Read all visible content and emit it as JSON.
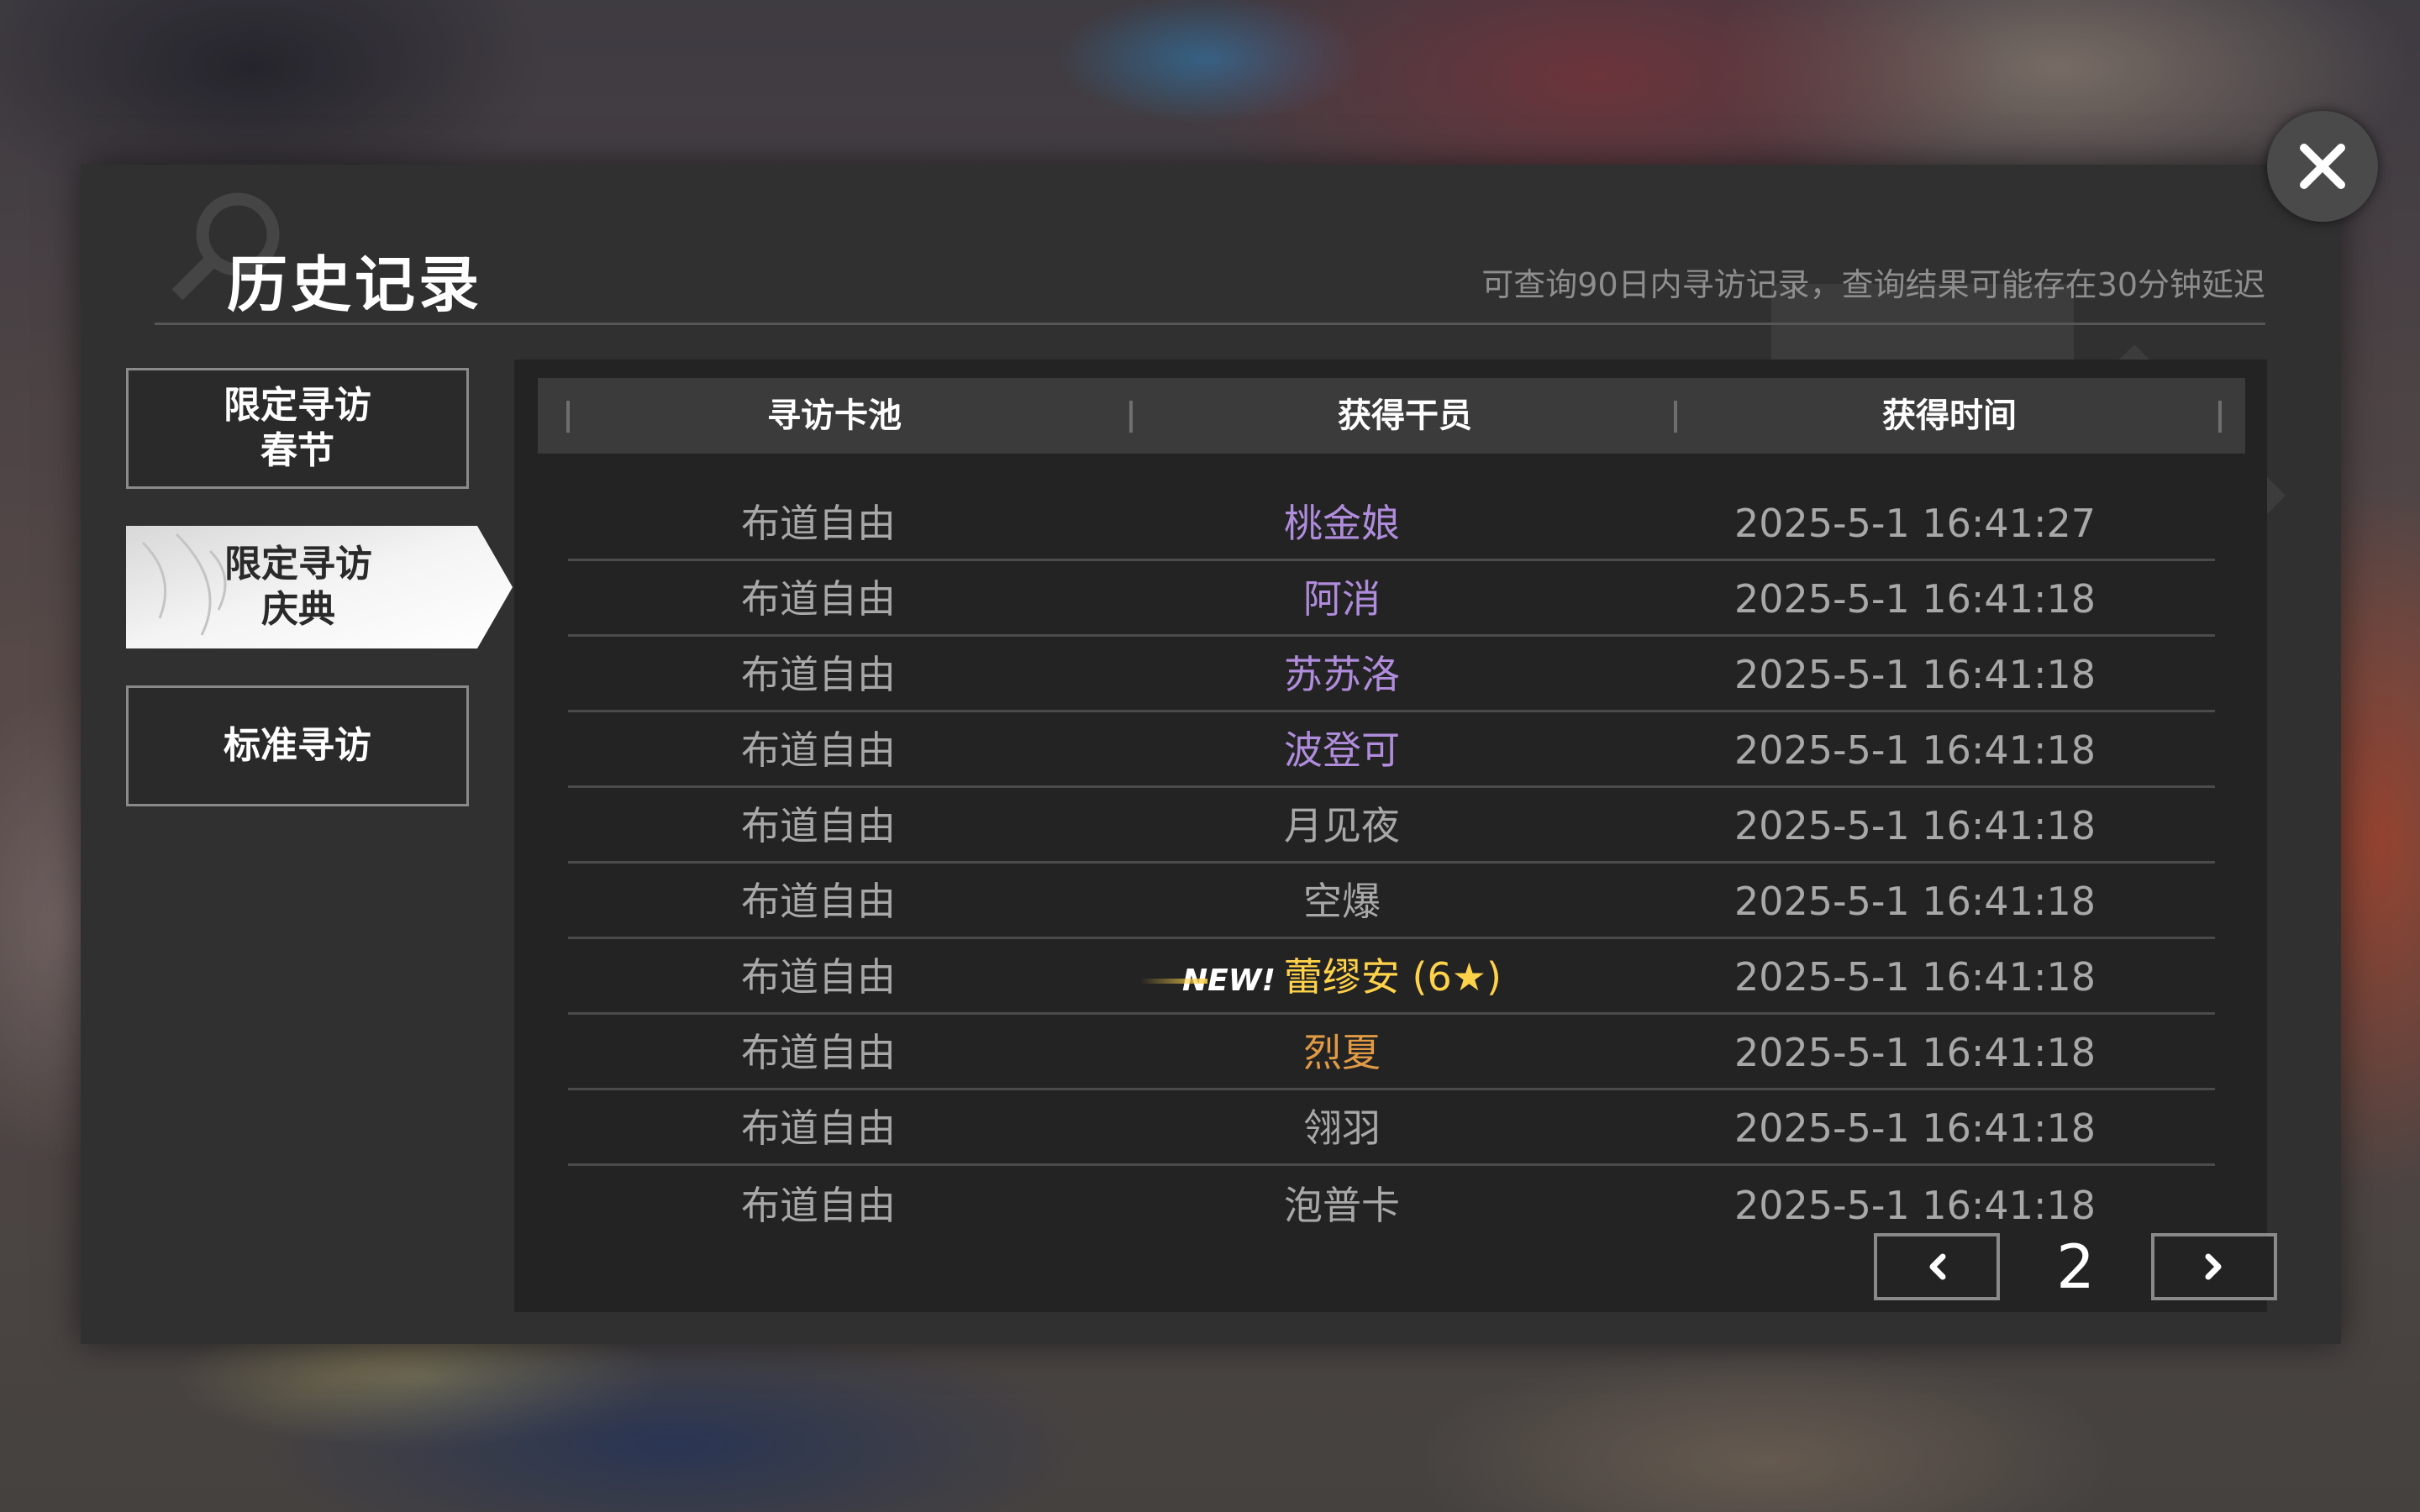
{
  "dialog": {
    "title": "历史记录",
    "subtitle": "可查询90日内寻访记录，查询结果可能存在30分钟延迟"
  },
  "sidebar": {
    "tabs": [
      {
        "line1": "限定寻访",
        "line2": "春节",
        "active": false
      },
      {
        "line1": "限定寻访",
        "line2": "庆典",
        "active": true
      },
      {
        "line1": "标准寻访",
        "line2": "",
        "active": false
      }
    ]
  },
  "table": {
    "headers": [
      "寻访卡池",
      "获得干员",
      "获得时间"
    ],
    "new_badge": "NEW!",
    "rows": [
      {
        "pool": "布道自由",
        "operator": "桃金娘",
        "time": "2025-5-1 16:41:27",
        "rarity": "purple"
      },
      {
        "pool": "布道自由",
        "operator": "阿消",
        "time": "2025-5-1 16:41:18",
        "rarity": "purple"
      },
      {
        "pool": "布道自由",
        "operator": "苏苏洛",
        "time": "2025-5-1 16:41:18",
        "rarity": "purple"
      },
      {
        "pool": "布道自由",
        "operator": "波登可",
        "time": "2025-5-1 16:41:18",
        "rarity": "purple"
      },
      {
        "pool": "布道自由",
        "operator": "月见夜",
        "time": "2025-5-1 16:41:18",
        "rarity": "gray"
      },
      {
        "pool": "布道自由",
        "operator": "空爆",
        "time": "2025-5-1 16:41:18",
        "rarity": "gray"
      },
      {
        "pool": "布道自由",
        "operator": "蕾缪安 (6★)",
        "time": "2025-5-1 16:41:18",
        "rarity": "gold",
        "is_new": true
      },
      {
        "pool": "布道自由",
        "operator": "烈夏",
        "time": "2025-5-1 16:41:18",
        "rarity": "orange"
      },
      {
        "pool": "布道自由",
        "operator": "翎羽",
        "time": "2025-5-1 16:41:18",
        "rarity": "gray"
      },
      {
        "pool": "布道自由",
        "operator": "泡普卡",
        "time": "2025-5-1 16:41:18",
        "rarity": "gray"
      }
    ]
  },
  "pagination": {
    "current_page": "2",
    "prev_icon": "chevron-left-icon",
    "next_icon": "chevron-right-icon"
  },
  "colors": {
    "panel": "#303030",
    "rarity_4": "#b08cdc",
    "rarity_5": "#e09a45",
    "rarity_6": "#ffd24a",
    "rarity_3": "#a8a8a8"
  },
  "close_icon": "close-icon"
}
